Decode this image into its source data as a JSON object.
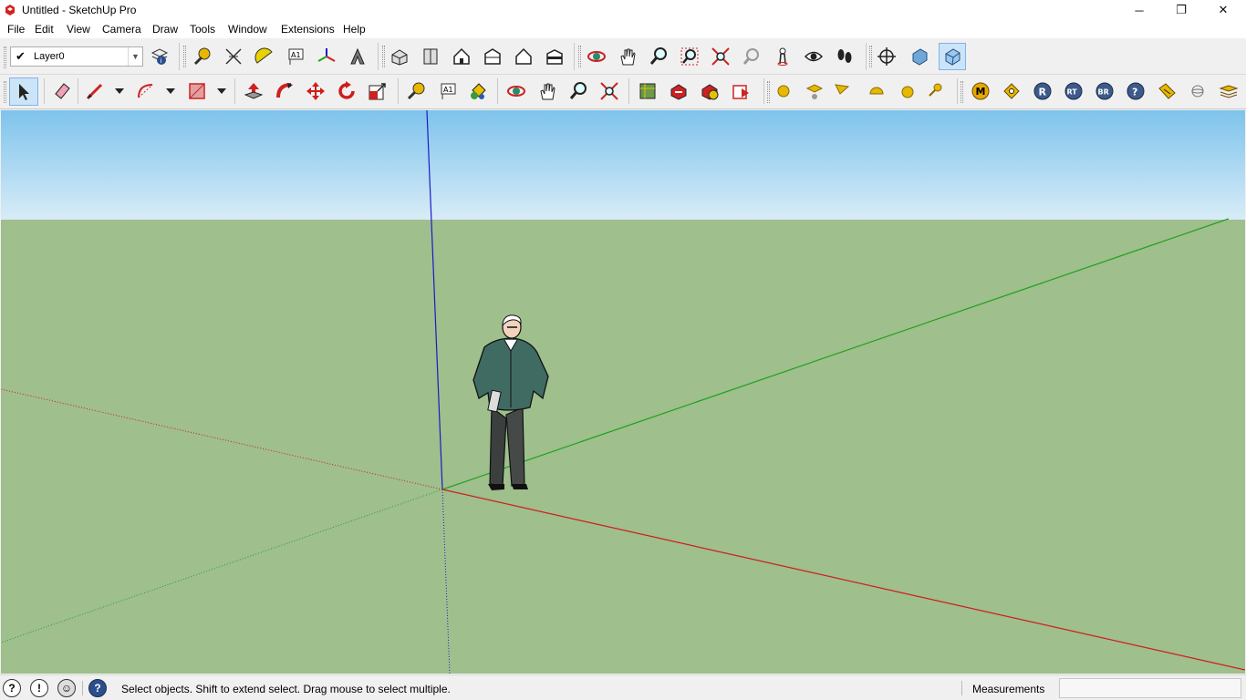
{
  "window": {
    "title": "Untitled - SketchUp Pro",
    "controls": {
      "minimize": "─",
      "maximize": "❐",
      "close": "✕"
    }
  },
  "menu": {
    "items": [
      "File",
      "Edit",
      "View",
      "Camera",
      "Draw",
      "Tools",
      "Window",
      "Extensions",
      "Help"
    ]
  },
  "layers": {
    "current": "Layer0"
  },
  "toolbar1": {
    "icons": [
      "layer-manager-icon",
      "tape-measure-icon",
      "dimension-icon",
      "protractor-icon",
      "text-icon",
      "axes-icon",
      "3d-text-icon",
      "iso-view-icon",
      "top-view-icon",
      "front-view-icon",
      "right-view-icon",
      "back-view-icon",
      "left-view-icon",
      "orbit-icon",
      "pan-icon",
      "zoom-icon",
      "zoom-window-icon",
      "zoom-extents-icon",
      "previous-view-icon",
      "position-camera-icon",
      "look-around-icon",
      "walk-icon",
      "section-plane-icon",
      "display-section-planes-icon",
      "display-section-cuts-icon"
    ]
  },
  "toolbar2": {
    "icons": [
      "select-icon",
      "eraser-icon",
      "line-icon",
      "arc-icon",
      "rectangle-icon",
      "push-pull-icon",
      "follow-me-icon",
      "move-icon",
      "rotate-icon",
      "scale-icon",
      "tape-measure-icon",
      "text-icon",
      "paint-bucket-icon",
      "orbit-icon",
      "pan-icon",
      "zoom-icon",
      "zoom-extents-icon",
      "3d-warehouse-icon",
      "share-model-icon",
      "get-models-icon",
      "send-to-layout-icon",
      "sphere-icon",
      "hat-icon",
      "flag-icon",
      "dome-icon",
      "ball-icon",
      "key-icon",
      "m-icon",
      "tag-icon",
      "r-icon",
      "rt-icon",
      "br-icon",
      "help-icon",
      "label-icon",
      "sphere-outline-icon",
      "layers-stack-icon"
    ]
  },
  "colors": {
    "sky_top": "#7ec3ec",
    "ground": "#9fbf8d",
    "axis_red": "#d01c1c",
    "axis_green": "#1fa31f",
    "axis_blue": "#1a1ac8"
  },
  "status": {
    "hint": "Select objects. Shift to extend select. Drag mouse to select multiple.",
    "measurements_label": "Measurements",
    "measurements_value": ""
  }
}
